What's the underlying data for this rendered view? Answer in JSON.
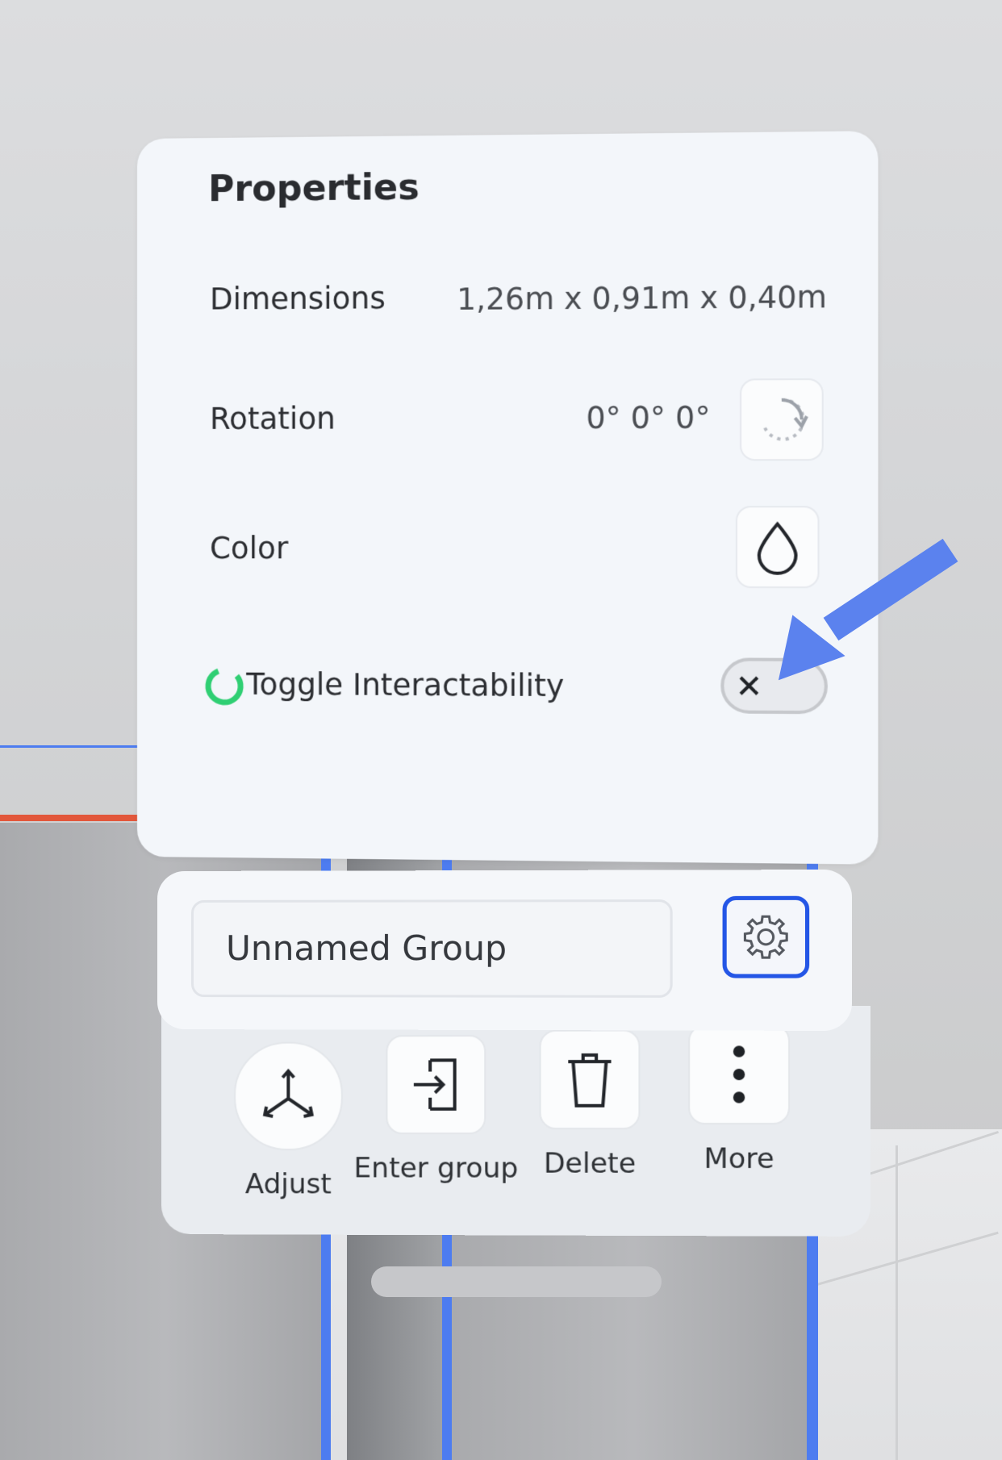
{
  "properties": {
    "title": "Properties",
    "dimensions": {
      "label": "Dimensions",
      "value": "1,26m x 0,91m x 0,40m"
    },
    "rotation": {
      "label": "Rotation",
      "value": "0° 0° 0°",
      "icon": "rotate-icon"
    },
    "color": {
      "label": "Color",
      "icon": "color-drop-icon"
    },
    "interactability": {
      "label": "Toggle Interactability",
      "state": "off",
      "icon": "loading-ring-icon"
    }
  },
  "group": {
    "name": "Unnamed Group",
    "settings_icon": "gear-icon",
    "actions": [
      {
        "label": "Adjust",
        "icon": "adjust-axes-icon"
      },
      {
        "label": "Enter group",
        "icon": "enter-group-icon"
      },
      {
        "label": "Delete",
        "icon": "trash-icon"
      },
      {
        "label": "More",
        "icon": "more-vertical-icon"
      }
    ]
  },
  "colors": {
    "accent": "#2456e6",
    "annotation_arrow": "#5b82ee",
    "spinner": "#2fcf73",
    "panel_bg": "#f3f6fa"
  }
}
